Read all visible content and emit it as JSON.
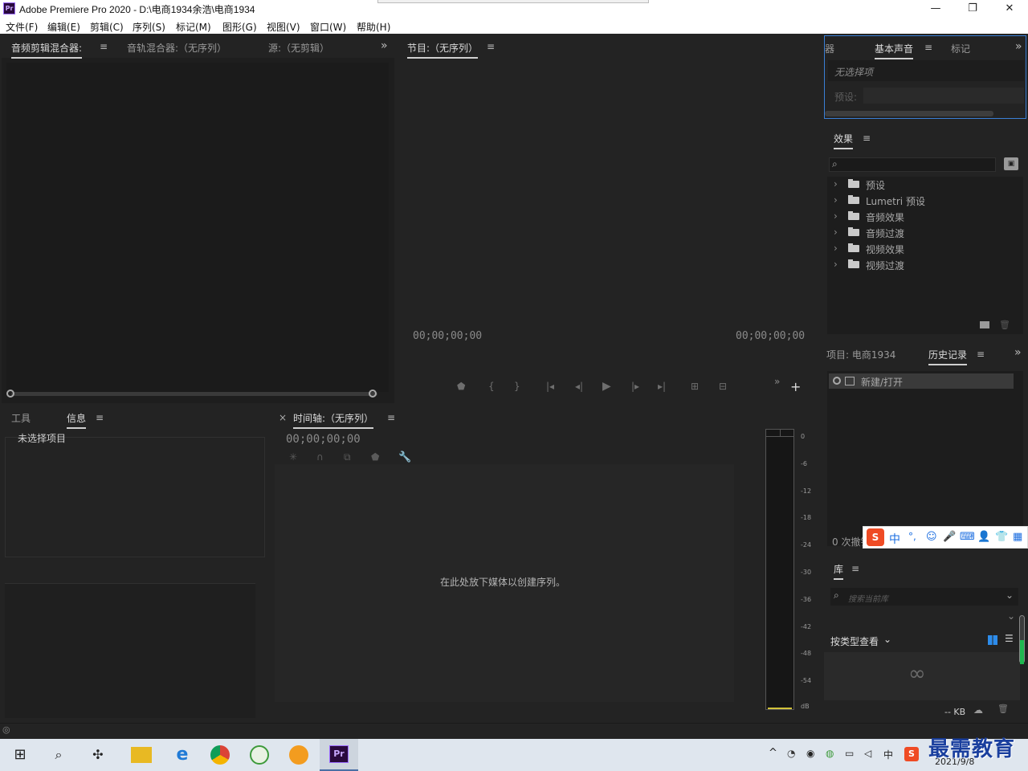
{
  "window": {
    "title": "Adobe Premiere Pro 2020 - D:\\电商1934余浩\\电商1934",
    "logo_text": "Pr",
    "minimize": "—",
    "maximize": "❐",
    "close": "✕"
  },
  "menu": [
    "文件(F)",
    "编辑(E)",
    "剪辑(C)",
    "序列(S)",
    "标记(M)",
    "图形(G)",
    "视图(V)",
    "窗口(W)",
    "帮助(H)"
  ],
  "source_panel": {
    "tabs": [
      "音频剪辑混合器:",
      "音轨混合器:（无序列）",
      "源:（无剪辑）"
    ],
    "menu_icon": "≡",
    "overflow": "»"
  },
  "program_panel": {
    "title": "节目:（无序列）",
    "menu_icon": "≡",
    "timecode_left": "00;00;00;00",
    "timecode_right": "00;00;00;00",
    "controls": [
      "marker-icon",
      "in-point-icon",
      "out-point-icon",
      "go-to-in-icon",
      "step-back-icon",
      "play-icon",
      "step-forward-icon",
      "go-to-out-icon",
      "lift-icon",
      "extract-icon"
    ],
    "overflow": "»",
    "add": "+"
  },
  "essential_sound": {
    "tabs": [
      "器",
      "基本声音",
      "标记"
    ],
    "menu_icon": "≡",
    "overflow": "»",
    "no_selection": "无选择项",
    "preset_label": "预设:"
  },
  "effects": {
    "title": "效果",
    "menu_icon": "≡",
    "search_placeholder": "",
    "items": [
      "预设",
      "Lumetri 预设",
      "音频效果",
      "音频过渡",
      "视频效果",
      "视频过渡"
    ]
  },
  "project": {
    "tabs": [
      "项目: 电商1934",
      "历史记录"
    ],
    "menu_icon": "≡",
    "overflow": "»",
    "history_item": "新建/打开",
    "undo_count": "0 次撤销"
  },
  "libraries": {
    "title": "库",
    "menu_icon": "≡",
    "search_placeholder": "搜索当前库",
    "view_by": "按类型查看",
    "size": "-- KB"
  },
  "info_panel": {
    "tabs": [
      "工具",
      "信息"
    ],
    "menu_icon": "≡",
    "no_selection": "未选择项目"
  },
  "timeline": {
    "close": "×",
    "title": "时间轴:（无序列）",
    "menu_icon": "≡",
    "timecode": "00;00;00;00",
    "drop_hint": "在此处放下媒体以创建序列。"
  },
  "audio_meter": {
    "labels": [
      "0",
      "-6",
      "-12",
      "-18",
      "-24",
      "-30",
      "-36",
      "-42",
      "-48",
      "-54",
      "dB"
    ]
  },
  "ime_bar": {
    "logo": "S",
    "items": [
      "中",
      "°,",
      "☺",
      "🎤",
      "⌨",
      "👤",
      "👕",
      "▦"
    ]
  },
  "taskbar": {
    "date": "2021/9/8",
    "watermark": "最需教育",
    "tray_lang": "中",
    "tray_up": "^"
  }
}
